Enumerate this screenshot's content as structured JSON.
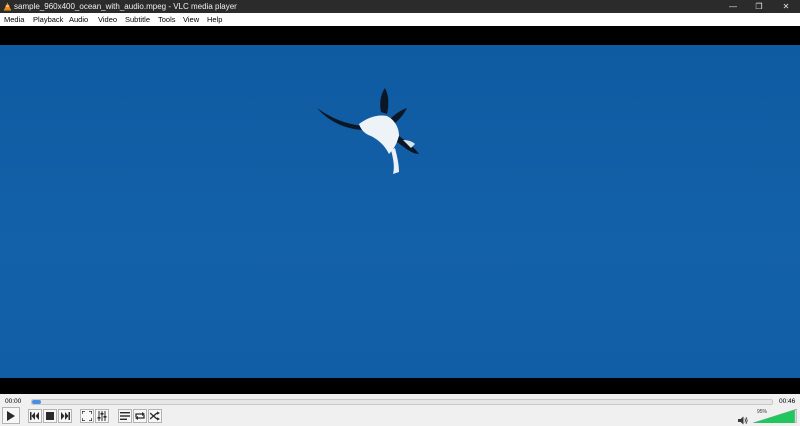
{
  "window": {
    "title": "sample_960x400_ocean_with_audio.mpeg - VLC media player",
    "minimize_icon": "minimize-icon",
    "restore_icon": "restore-icon",
    "close_icon": "close-icon"
  },
  "menu": {
    "items": [
      "Media",
      "Playback",
      "Audio",
      "Video",
      "Subtitle",
      "Tools",
      "View",
      "Help"
    ]
  },
  "player": {
    "elapsed": "00:00",
    "total": "00:46",
    "progress": 0.012,
    "volume": "95%",
    "volume_level": 0.95,
    "colors": {
      "accent": "#4a90e2",
      "volume_fill": "#22c55e",
      "sky": "#0f5ca3"
    }
  }
}
